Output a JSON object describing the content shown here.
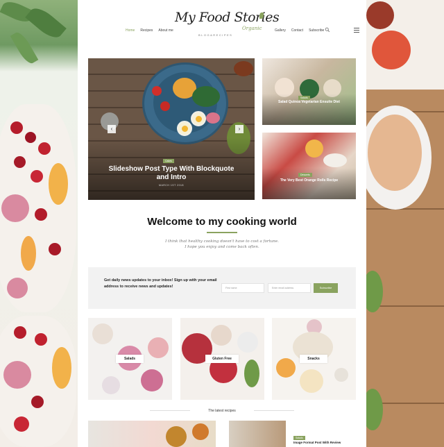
{
  "nav": {
    "left": [
      "Home",
      "Recipes",
      "About me"
    ],
    "right": [
      "Gallery",
      "Contact",
      "Subscribe"
    ]
  },
  "logo": {
    "main": "My Food Stories",
    "accent": "Organic",
    "tagline": "BLOG&RECIPES"
  },
  "hero": {
    "badge": "Cakes",
    "title": "Slideshow Post Type With Blockquote and Intro",
    "date": "MARCH 1ST 2018"
  },
  "side_cards": [
    {
      "badge": "Salads",
      "title": "Salad Quinoa Vegetarian Ensuite Diet"
    },
    {
      "badge": "Desserts",
      "title": "The Very Best Orange Rolls Recipe"
    }
  ],
  "welcome": {
    "title": "Welcome to my cooking world",
    "text_line1": "I think that healthy cooking doesn't have to cost a fortune.",
    "text_line2": "I hope you enjoy and come back often."
  },
  "newsletter": {
    "text": "Get daily news updates to your inbox! Sign up with your email address to receive news and updates!",
    "first_name_placeholder": "First name",
    "email_placeholder": "Enter email address",
    "button": "Subscribe"
  },
  "categories": [
    "Salads",
    "Gluten Free",
    "Snacks"
  ],
  "latest": {
    "title": "The latest recipes",
    "badge": "Salads",
    "post_title": "Image Format Post With Review"
  },
  "colors": {
    "accent": "#8aa35f",
    "newsletter_bg": "#f2f2f2"
  }
}
